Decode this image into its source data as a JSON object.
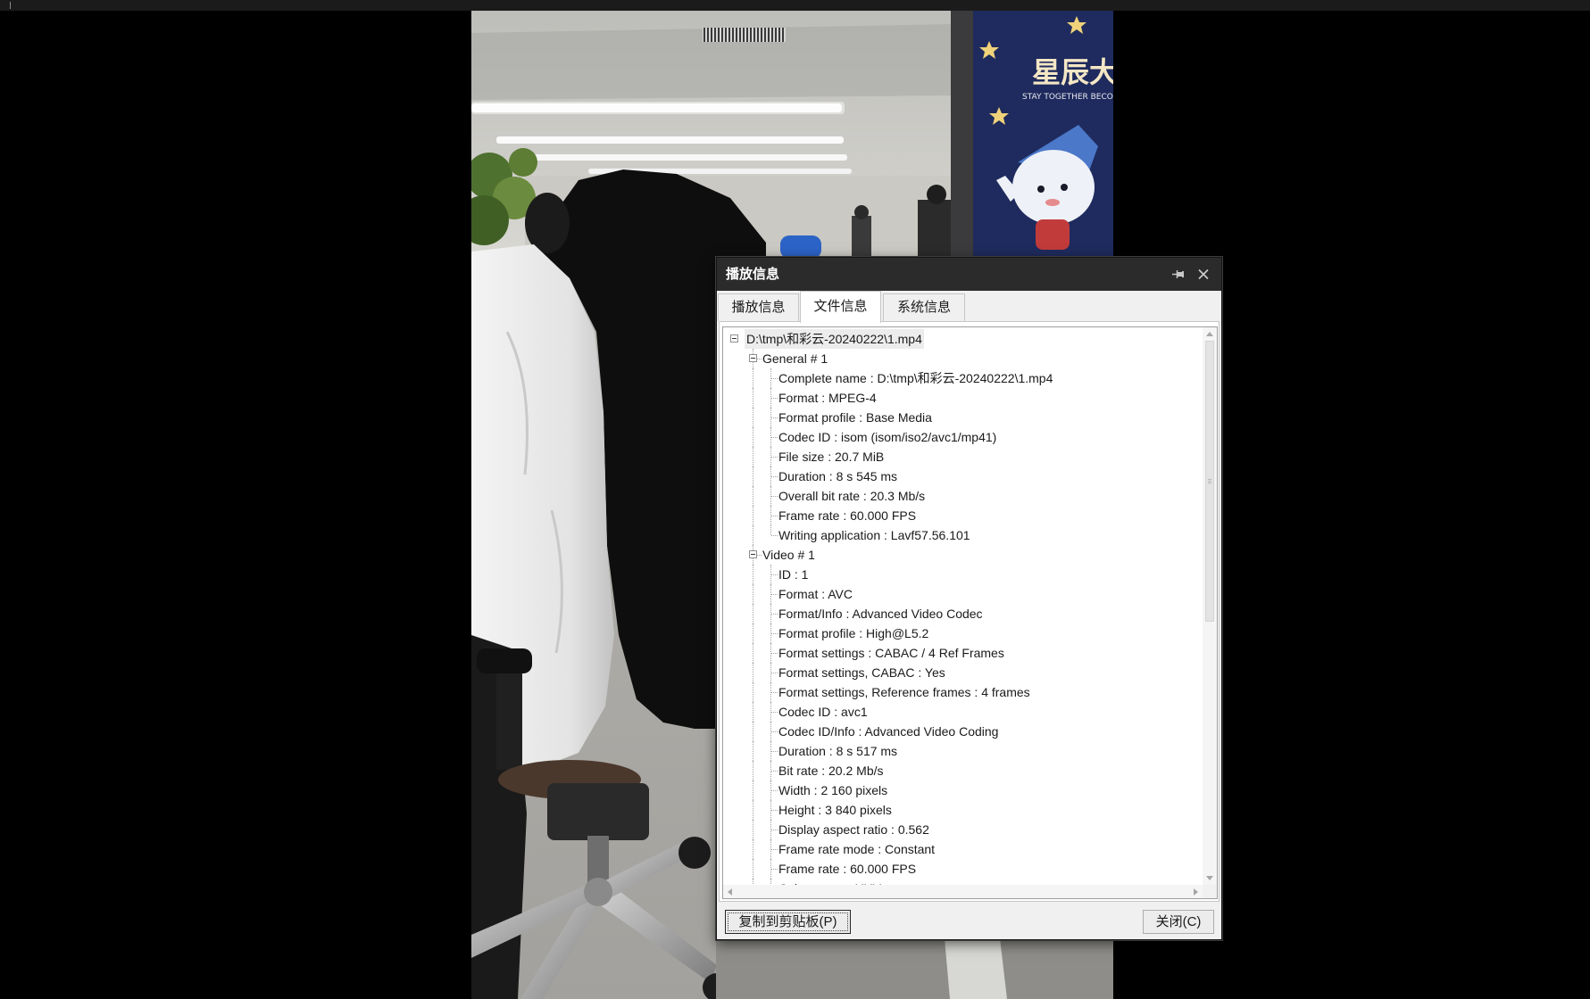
{
  "colors": {
    "title_bar": "#2b2b2b",
    "dialog_bg": "#f0f0f0"
  },
  "icons": {
    "pin": "pin-icon",
    "close": "close-icon",
    "expander": "collapse-toggle-icon",
    "scroll_up": "scroll-up-arrow-icon",
    "scroll_down": "scroll-down-arrow-icon",
    "scroll_left": "scroll-left-arrow-icon",
    "scroll_right": "scroll-right-arrow-icon"
  },
  "video": {
    "poster_title": "星辰大",
    "poster_subtitle": "STAY TOGETHER BECO"
  },
  "dialog": {
    "title": "播放信息",
    "tabs": [
      "播放信息",
      "文件信息",
      "系统信息"
    ],
    "active_tab_index": 1,
    "tree": {
      "root": "D:\\tmp\\和彩云-20240222\\1.mp4",
      "sections": [
        {
          "label": "General # 1",
          "items": [
            "Complete name : D:\\tmp\\和彩云-20240222\\1.mp4",
            "Format : MPEG-4",
            "Format profile : Base Media",
            "Codec ID : isom (isom/iso2/avc1/mp41)",
            "File size : 20.7 MiB",
            "Duration : 8 s 545 ms",
            "Overall bit rate : 20.3 Mb/s",
            "Frame rate : 60.000 FPS",
            "Writing application : Lavf57.56.101"
          ]
        },
        {
          "label": "Video # 1",
          "items": [
            "ID : 1",
            "Format : AVC",
            "Format/Info : Advanced Video Codec",
            "Format profile : High@L5.2",
            "Format settings : CABAC / 4 Ref Frames",
            "Format settings, CABAC : Yes",
            "Format settings, Reference frames : 4 frames",
            "Codec ID : avc1",
            "Codec ID/Info : Advanced Video Coding",
            "Duration : 8 s 517 ms",
            "Bit rate : 20.2 Mb/s",
            "Width : 2 160 pixels",
            "Height : 3 840 pixels",
            "Display aspect ratio : 0.562",
            "Frame rate mode : Constant",
            "Frame rate : 60.000 FPS",
            "Color space : YUV"
          ]
        }
      ]
    },
    "scroll": {
      "vertical_position": 0,
      "visible_fraction": 0.53
    },
    "buttons": {
      "copy": "复制到剪贴板(P)",
      "close": "关闭(C)"
    }
  }
}
